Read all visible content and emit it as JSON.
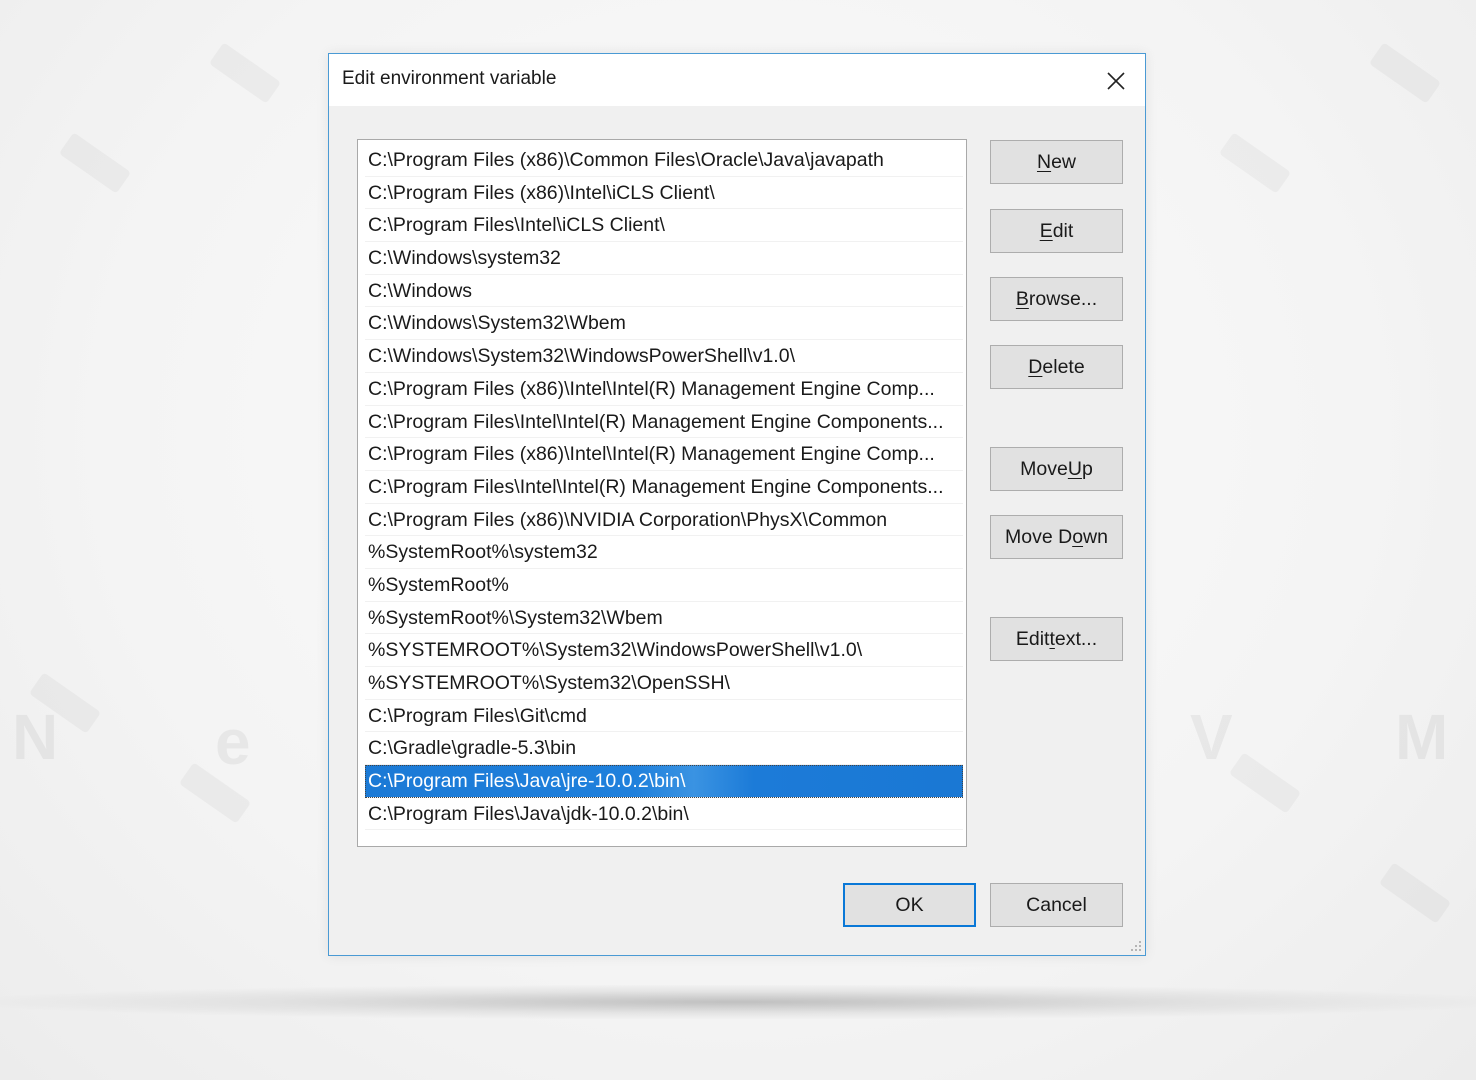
{
  "dialog": {
    "title": "Edit environment variable",
    "close_icon": "close-icon"
  },
  "path_list": {
    "selected_index": 19,
    "items": [
      "C:\\Program Files (x86)\\Common Files\\Oracle\\Java\\javapath",
      "C:\\Program Files (x86)\\Intel\\iCLS Client\\",
      "C:\\Program Files\\Intel\\iCLS Client\\",
      "C:\\Windows\\system32",
      "C:\\Windows",
      "C:\\Windows\\System32\\Wbem",
      "C:\\Windows\\System32\\WindowsPowerShell\\v1.0\\",
      "C:\\Program Files (x86)\\Intel\\Intel(R) Management Engine Comp...",
      "C:\\Program Files\\Intel\\Intel(R) Management Engine Components...",
      "C:\\Program Files (x86)\\Intel\\Intel(R) Management Engine Comp...",
      "C:\\Program Files\\Intel\\Intel(R) Management Engine Components...",
      "C:\\Program Files (x86)\\NVIDIA Corporation\\PhysX\\Common",
      "%SystemRoot%\\system32",
      "%SystemRoot%",
      "%SystemRoot%\\System32\\Wbem",
      "%SYSTEMROOT%\\System32\\WindowsPowerShell\\v1.0\\",
      "%SYSTEMROOT%\\System32\\OpenSSH\\",
      "C:\\Program Files\\Git\\cmd",
      "C:\\Gradle\\gradle-5.3\\bin",
      "C:\\Program Files\\Java\\jre-10.0.2\\bin\\",
      "C:\\Program Files\\Java\\jdk-10.0.2\\bin\\"
    ]
  },
  "buttons": {
    "new": {
      "pre": "",
      "key": "N",
      "post": "ew"
    },
    "edit": {
      "pre": "",
      "key": "E",
      "post": "dit"
    },
    "browse": {
      "pre": "",
      "key": "B",
      "post": "rowse..."
    },
    "delete": {
      "pre": "",
      "key": "D",
      "post": "elete"
    },
    "move_up": {
      "pre": "Move ",
      "key": "U",
      "post": "p"
    },
    "move_down": {
      "pre": "Move D",
      "key": "o",
      "post": "wn"
    },
    "edit_text": {
      "pre": "Edit ",
      "key": "t",
      "post": "ext..."
    },
    "ok": "OK",
    "cancel": "Cancel"
  },
  "colors": {
    "selection": "#1a78d4",
    "dialog_border": "#4a9ad4",
    "default_button_border": "#0a78d7"
  }
}
